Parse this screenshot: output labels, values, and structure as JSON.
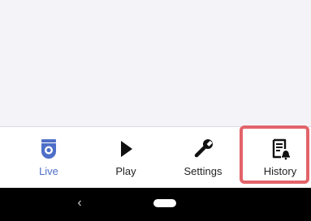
{
  "bottom_nav": {
    "items": [
      {
        "label": "Live",
        "icon": "camera-icon",
        "active": true
      },
      {
        "label": "Play",
        "icon": "play-icon",
        "active": false
      },
      {
        "label": "Settings",
        "icon": "wrench-icon",
        "active": false
      },
      {
        "label": "History",
        "icon": "history-doc-bell-icon",
        "active": false
      }
    ]
  },
  "colors": {
    "active": "#4e6fc8",
    "inactive": "#222222",
    "highlight": "#e2646a",
    "system_bar": "#000000"
  },
  "system_bar": {
    "back_icon": "chevron-left-icon",
    "home_icon": "home-pill-icon"
  }
}
